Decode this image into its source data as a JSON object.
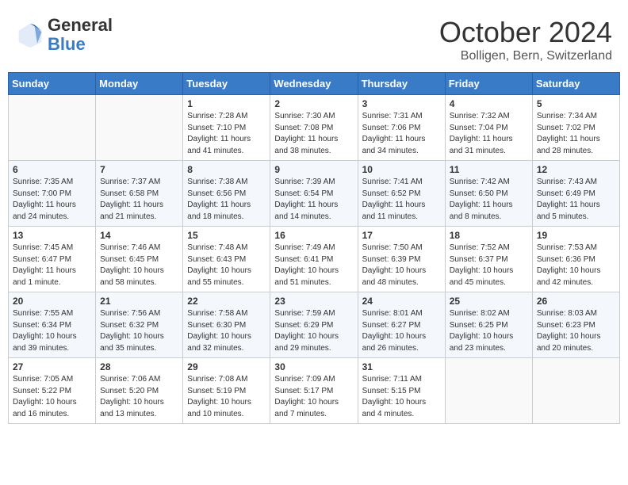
{
  "header": {
    "logo_line1": "General",
    "logo_line2": "Blue",
    "month": "October 2024",
    "location": "Bolligen, Bern, Switzerland"
  },
  "days_of_week": [
    "Sunday",
    "Monday",
    "Tuesday",
    "Wednesday",
    "Thursday",
    "Friday",
    "Saturday"
  ],
  "weeks": [
    [
      {
        "day": "",
        "info": ""
      },
      {
        "day": "",
        "info": ""
      },
      {
        "day": "1",
        "info": "Sunrise: 7:28 AM\nSunset: 7:10 PM\nDaylight: 11 hours and 41 minutes."
      },
      {
        "day": "2",
        "info": "Sunrise: 7:30 AM\nSunset: 7:08 PM\nDaylight: 11 hours and 38 minutes."
      },
      {
        "day": "3",
        "info": "Sunrise: 7:31 AM\nSunset: 7:06 PM\nDaylight: 11 hours and 34 minutes."
      },
      {
        "day": "4",
        "info": "Sunrise: 7:32 AM\nSunset: 7:04 PM\nDaylight: 11 hours and 31 minutes."
      },
      {
        "day": "5",
        "info": "Sunrise: 7:34 AM\nSunset: 7:02 PM\nDaylight: 11 hours and 28 minutes."
      }
    ],
    [
      {
        "day": "6",
        "info": "Sunrise: 7:35 AM\nSunset: 7:00 PM\nDaylight: 11 hours and 24 minutes."
      },
      {
        "day": "7",
        "info": "Sunrise: 7:37 AM\nSunset: 6:58 PM\nDaylight: 11 hours and 21 minutes."
      },
      {
        "day": "8",
        "info": "Sunrise: 7:38 AM\nSunset: 6:56 PM\nDaylight: 11 hours and 18 minutes."
      },
      {
        "day": "9",
        "info": "Sunrise: 7:39 AM\nSunset: 6:54 PM\nDaylight: 11 hours and 14 minutes."
      },
      {
        "day": "10",
        "info": "Sunrise: 7:41 AM\nSunset: 6:52 PM\nDaylight: 11 hours and 11 minutes."
      },
      {
        "day": "11",
        "info": "Sunrise: 7:42 AM\nSunset: 6:50 PM\nDaylight: 11 hours and 8 minutes."
      },
      {
        "day": "12",
        "info": "Sunrise: 7:43 AM\nSunset: 6:49 PM\nDaylight: 11 hours and 5 minutes."
      }
    ],
    [
      {
        "day": "13",
        "info": "Sunrise: 7:45 AM\nSunset: 6:47 PM\nDaylight: 11 hours and 1 minute."
      },
      {
        "day": "14",
        "info": "Sunrise: 7:46 AM\nSunset: 6:45 PM\nDaylight: 10 hours and 58 minutes."
      },
      {
        "day": "15",
        "info": "Sunrise: 7:48 AM\nSunset: 6:43 PM\nDaylight: 10 hours and 55 minutes."
      },
      {
        "day": "16",
        "info": "Sunrise: 7:49 AM\nSunset: 6:41 PM\nDaylight: 10 hours and 51 minutes."
      },
      {
        "day": "17",
        "info": "Sunrise: 7:50 AM\nSunset: 6:39 PM\nDaylight: 10 hours and 48 minutes."
      },
      {
        "day": "18",
        "info": "Sunrise: 7:52 AM\nSunset: 6:37 PM\nDaylight: 10 hours and 45 minutes."
      },
      {
        "day": "19",
        "info": "Sunrise: 7:53 AM\nSunset: 6:36 PM\nDaylight: 10 hours and 42 minutes."
      }
    ],
    [
      {
        "day": "20",
        "info": "Sunrise: 7:55 AM\nSunset: 6:34 PM\nDaylight: 10 hours and 39 minutes."
      },
      {
        "day": "21",
        "info": "Sunrise: 7:56 AM\nSunset: 6:32 PM\nDaylight: 10 hours and 35 minutes."
      },
      {
        "day": "22",
        "info": "Sunrise: 7:58 AM\nSunset: 6:30 PM\nDaylight: 10 hours and 32 minutes."
      },
      {
        "day": "23",
        "info": "Sunrise: 7:59 AM\nSunset: 6:29 PM\nDaylight: 10 hours and 29 minutes."
      },
      {
        "day": "24",
        "info": "Sunrise: 8:01 AM\nSunset: 6:27 PM\nDaylight: 10 hours and 26 minutes."
      },
      {
        "day": "25",
        "info": "Sunrise: 8:02 AM\nSunset: 6:25 PM\nDaylight: 10 hours and 23 minutes."
      },
      {
        "day": "26",
        "info": "Sunrise: 8:03 AM\nSunset: 6:23 PM\nDaylight: 10 hours and 20 minutes."
      }
    ],
    [
      {
        "day": "27",
        "info": "Sunrise: 7:05 AM\nSunset: 5:22 PM\nDaylight: 10 hours and 16 minutes."
      },
      {
        "day": "28",
        "info": "Sunrise: 7:06 AM\nSunset: 5:20 PM\nDaylight: 10 hours and 13 minutes."
      },
      {
        "day": "29",
        "info": "Sunrise: 7:08 AM\nSunset: 5:19 PM\nDaylight: 10 hours and 10 minutes."
      },
      {
        "day": "30",
        "info": "Sunrise: 7:09 AM\nSunset: 5:17 PM\nDaylight: 10 hours and 7 minutes."
      },
      {
        "day": "31",
        "info": "Sunrise: 7:11 AM\nSunset: 5:15 PM\nDaylight: 10 hours and 4 minutes."
      },
      {
        "day": "",
        "info": ""
      },
      {
        "day": "",
        "info": ""
      }
    ]
  ]
}
